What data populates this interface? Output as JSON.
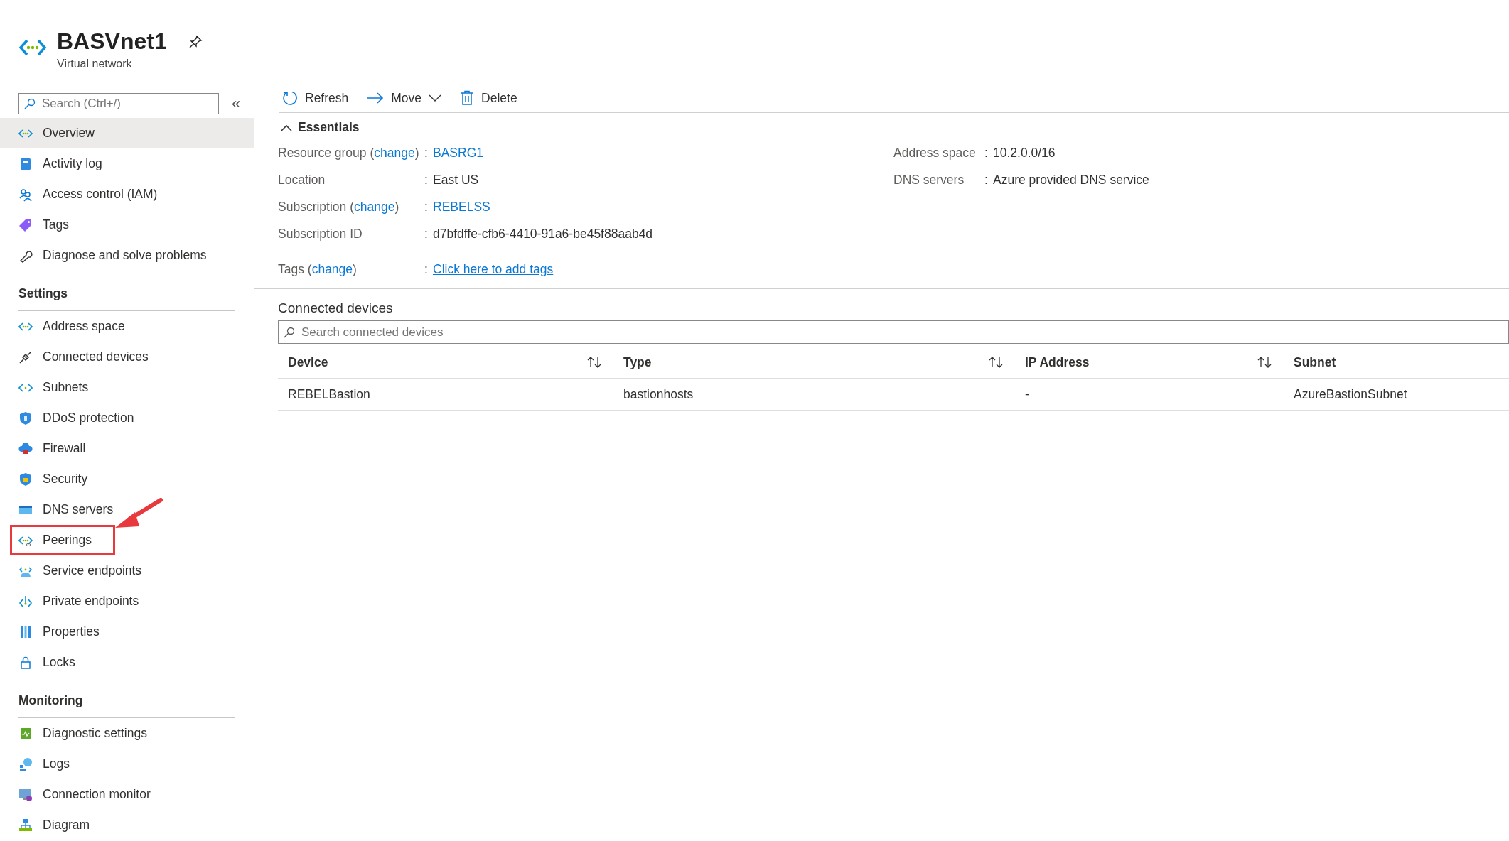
{
  "header": {
    "title": "BASVnet1",
    "subtitle": "Virtual network"
  },
  "sidebar": {
    "search": {
      "placeholder": "Search (Ctrl+/)"
    },
    "collapse": "«",
    "groups": [
      {
        "items": [
          {
            "label": "Overview",
            "kind": "network",
            "selected": true,
            "annotated": false
          },
          {
            "label": "Activity log",
            "kind": "log",
            "selected": false,
            "annotated": false
          },
          {
            "label": "Access control (IAM)",
            "kind": "people",
            "selected": false,
            "annotated": false
          },
          {
            "label": "Tags",
            "kind": "tag",
            "selected": false,
            "annotated": false
          },
          {
            "label": "Diagnose and solve problems",
            "kind": "wrench",
            "selected": false,
            "annotated": false
          }
        ]
      },
      {
        "heading": "Settings",
        "items": [
          {
            "label": "Address space",
            "kind": "network",
            "selected": false,
            "annotated": false
          },
          {
            "label": "Connected devices",
            "kind": "plug",
            "selected": false,
            "annotated": false
          },
          {
            "label": "Subnets",
            "kind": "subnet",
            "selected": false,
            "annotated": false
          },
          {
            "label": "DDoS protection",
            "kind": "shield",
            "selected": false,
            "annotated": false
          },
          {
            "label": "Firewall",
            "kind": "cloud",
            "selected": false,
            "annotated": false
          },
          {
            "label": "Security",
            "kind": "lockshield",
            "selected": false,
            "annotated": false
          },
          {
            "label": "DNS servers",
            "kind": "server",
            "selected": false,
            "annotated": false
          },
          {
            "label": "Peerings",
            "kind": "peering",
            "selected": false,
            "annotated": true
          },
          {
            "label": "Service endpoints",
            "kind": "endpoint",
            "selected": false,
            "annotated": false
          },
          {
            "label": "Private endpoints",
            "kind": "private",
            "selected": false,
            "annotated": false
          },
          {
            "label": "Properties",
            "kind": "bars",
            "selected": false,
            "annotated": false
          },
          {
            "label": "Locks",
            "kind": "lock",
            "selected": false,
            "annotated": false
          }
        ]
      },
      {
        "heading": "Monitoring",
        "items": [
          {
            "label": "Diagnostic settings",
            "kind": "book",
            "selected": false,
            "annotated": false
          },
          {
            "label": "Logs",
            "kind": "logs",
            "selected": false,
            "annotated": false
          },
          {
            "label": "Connection monitor",
            "kind": "monitor",
            "selected": false,
            "annotated": false
          },
          {
            "label": "Diagram",
            "kind": "tree",
            "selected": false,
            "annotated": false
          }
        ]
      }
    ]
  },
  "toolbar": [
    {
      "label": "Refresh",
      "kind": "refresh"
    },
    {
      "label": "Move",
      "kind": "move"
    },
    {
      "label": "Delete",
      "kind": "delete"
    }
  ],
  "essentials": {
    "title": "Essentials",
    "expanded": true,
    "left": [
      {
        "label": "Resource group (",
        "change": "change",
        "after": ")",
        "separator": ":",
        "value": "BASRG1",
        "kind": "link"
      },
      {
        "label": "Location",
        "separator": ":",
        "value": "East US",
        "kind": "text"
      },
      {
        "label": "Subscription (",
        "change": "change",
        "after": ")",
        "separator": ":",
        "value": "REBELSS",
        "kind": "link"
      },
      {
        "label": "Subscription ID",
        "separator": ":",
        "value": "d7bfdffe-cfb6-4410-91a6-be45f88aab4d",
        "kind": "text"
      },
      {
        "label": "Tags (",
        "change": "change",
        "after": ")",
        "separator": ":",
        "value": "Click here to add tags",
        "kind": "underlined"
      }
    ],
    "right": [
      {
        "label": "Address space",
        "separator": ":",
        "value": "10.2.0.0/16"
      },
      {
        "label": "DNS servers",
        "separator": ":",
        "value": "Azure provided DNS service"
      }
    ]
  },
  "connected_devices": {
    "title": "Connected devices",
    "search": {
      "placeholder": "Search connected devices"
    },
    "columns": [
      {
        "label": "Device",
        "sortable": true
      },
      {
        "label": "Type",
        "sortable": true
      },
      {
        "label": "IP Address",
        "sortable": true
      },
      {
        "label": "Subnet",
        "sortable": false
      }
    ],
    "rows": [
      [
        "REBELBastion",
        "bastionhosts",
        "-",
        "AzureBastionSubnet"
      ]
    ]
  }
}
